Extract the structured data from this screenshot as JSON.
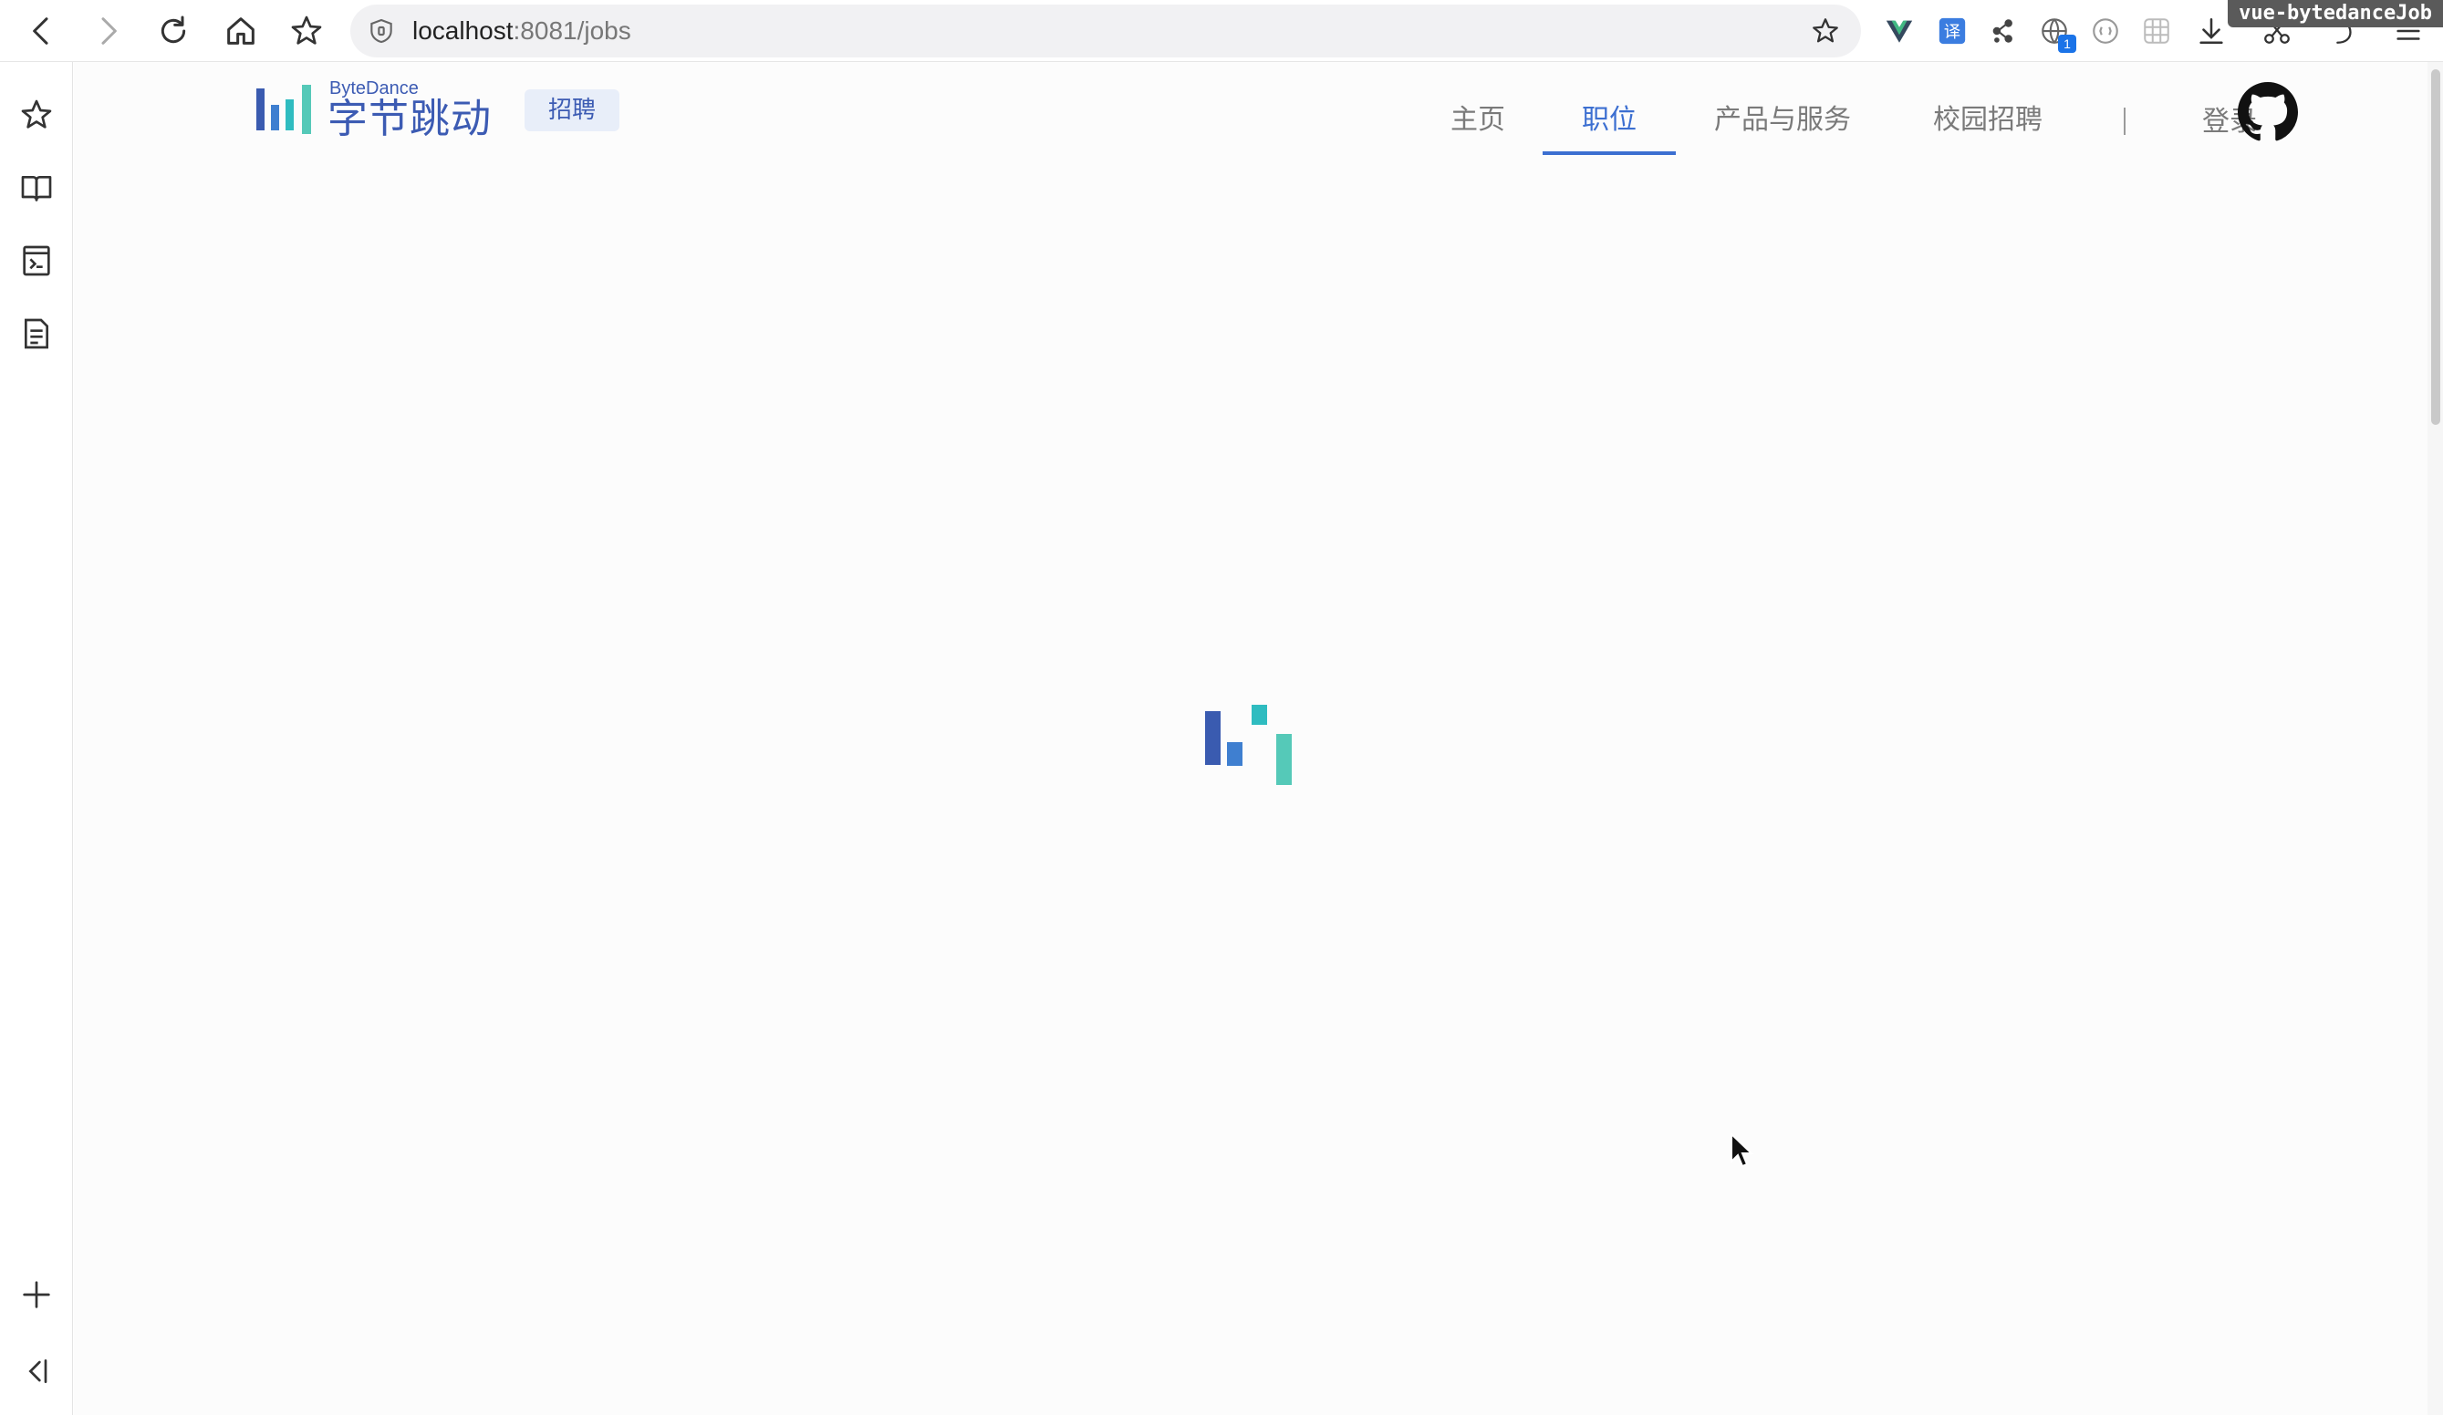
{
  "browser": {
    "url_host": "localhost",
    "url_rest": ":8081/jobs",
    "extension_badge": "1",
    "tab_tooltip": "vue-bytedanceJob"
  },
  "header": {
    "brand_en": "ByteDance",
    "brand_cn": "字节跳动",
    "brand_tag": "招聘",
    "nav": [
      {
        "label": "主页"
      },
      {
        "label": "职位"
      },
      {
        "label": "产品与服务"
      },
      {
        "label": "校园招聘"
      }
    ],
    "active_nav": "职位",
    "login_label": "登录"
  },
  "colors": {
    "brand_blue": "#3c5bb3",
    "nav_active": "#3c6fd1",
    "loader_dark": "#3a5bb0",
    "loader_mid": "#3f7fd0",
    "loader_teal_light": "#2fbcc0",
    "loader_teal": "#55c9b8"
  },
  "icons": {
    "sidebar": [
      "star-icon",
      "reading-list-icon",
      "screenshot-icon",
      "notes-icon",
      "add-icon",
      "collapse-sidebar-icon"
    ],
    "toolbar": [
      "back-icon",
      "forward-icon",
      "reload-icon",
      "home-icon",
      "bookmark-star-icon"
    ],
    "extensions": [
      "vue-devtools-icon",
      "translate-icon",
      "network-icon",
      "extension-badge-icon",
      "circle-icon",
      "grid-icon",
      "download-icon",
      "tools-icon",
      "undo-icon",
      "menu-icon"
    ]
  }
}
